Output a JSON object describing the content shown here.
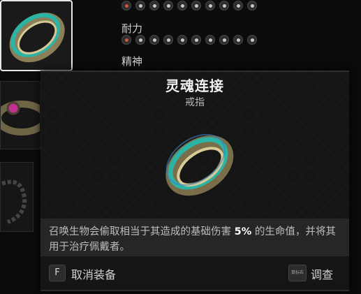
{
  "stats": {
    "top_row_active_count": 1,
    "endurance_label": "耐力",
    "endurance_active_count": 1,
    "spirit_label": "精神",
    "pips_per_row": 10
  },
  "tooltip": {
    "name": "灵魂连接",
    "type": "戒指",
    "description_before": "召唤生物会偷取相当于其造成的基础伤害 ",
    "description_highlight": "5%",
    "description_after": " 的生命值，并将其用于治疗佩戴者。",
    "unequip_key": "F",
    "unequip_label": "取消装备",
    "inspect_key": "鼠标右",
    "inspect_label": "调查"
  },
  "colors": {
    "ring_band_teal": "#2bb3a6",
    "ring_metal": "#c9b98a",
    "active_pip": "#d1553a",
    "gem_magenta": "#c0308f"
  }
}
